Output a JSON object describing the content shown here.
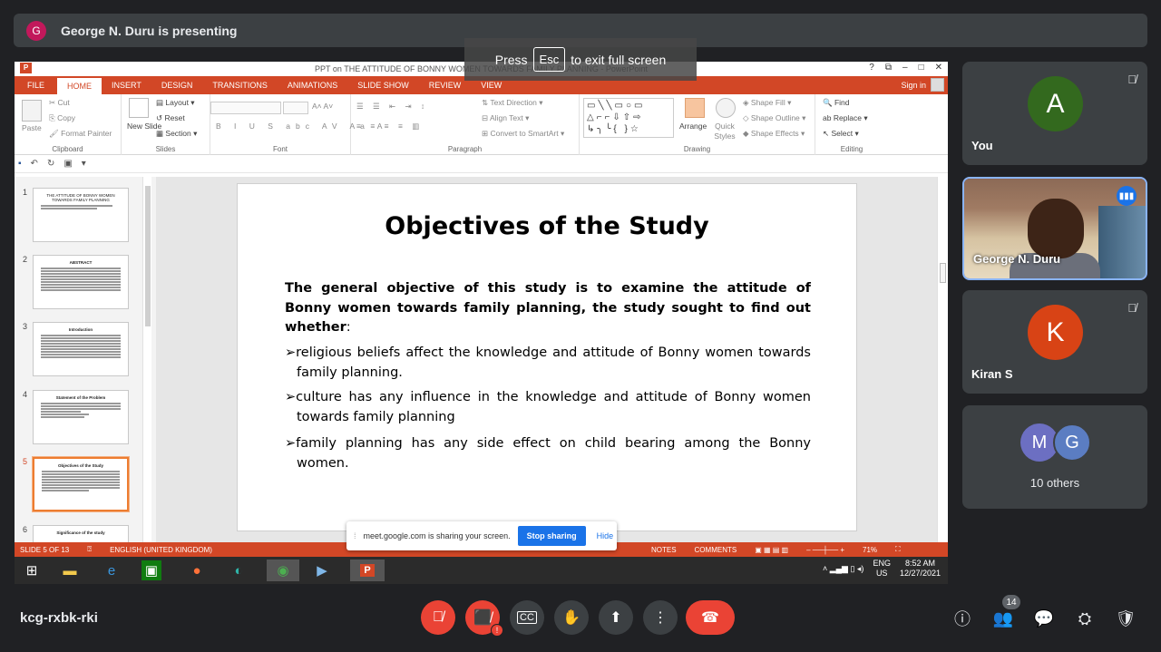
{
  "banner": {
    "avatar_letter": "G",
    "text": "George N. Duru is presenting"
  },
  "fullscreen_notice": {
    "before": "Press",
    "key": "Esc",
    "after": "to exit full screen"
  },
  "ppt": {
    "app_icon": "P",
    "title": "PPT on THE ATTITUDE OF BONNY WOMEN TOWARDS FAMILY PLANNING - PowerPoint",
    "window_controls": [
      "?",
      "⧉",
      "–",
      "□",
      "✕"
    ],
    "tabs": [
      "FILE",
      "HOME",
      "INSERT",
      "DESIGN",
      "TRANSITIONS",
      "ANIMATIONS",
      "SLIDE SHOW",
      "REVIEW",
      "VIEW"
    ],
    "sign_in": "Sign in",
    "ribbon": {
      "clipboard": {
        "paste": "Paste",
        "cut": "Cut",
        "copy": "Copy",
        "format_painter": "Format Painter",
        "label": "Clipboard"
      },
      "slides": {
        "new_slide": "New Slide",
        "layout": "Layout",
        "reset": "Reset",
        "section": "Section",
        "label": "Slides"
      },
      "font": {
        "label": "Font"
      },
      "paragraph": {
        "text_direction": "Text Direction",
        "align_text": "Align Text",
        "convert": "Convert to SmartArt",
        "label": "Paragraph"
      },
      "drawing": {
        "arrange": "Arrange",
        "quick_styles": "Quick Styles",
        "shape_fill": "Shape Fill",
        "shape_outline": "Shape Outline",
        "shape_effects": "Shape Effects",
        "label": "Drawing"
      },
      "editing": {
        "find": "Find",
        "replace": "Replace",
        "select": "Select",
        "label": "Editing"
      }
    },
    "thumbnails": [
      {
        "num": "1",
        "title": "THE ATTITUDE OF BONNY WOMEN TOWARDS FAMILY PLANNING"
      },
      {
        "num": "2",
        "title": "ABSTRACT"
      },
      {
        "num": "3",
        "title": "Introduction"
      },
      {
        "num": "4",
        "title": "Statement of the Problem"
      },
      {
        "num": "5",
        "title": "Objectives of the Study"
      },
      {
        "num": "6",
        "title": "Significance of the study"
      }
    ],
    "slide": {
      "title": "Objectives of the Study",
      "lead": "The general objective of this study is to examine the attitude of Bonny women towards family planning, the study sought to find out whether",
      "lead_end": ":",
      "bullet_marker": "➢",
      "bullets": [
        "religious beliefs affect the knowledge and attitude of Bonny women towards family planning.",
        "culture has any influence in the knowledge and attitude of Bonny women towards family planning",
        "family planning has any side effect on child bearing among the Bonny women."
      ]
    },
    "status": {
      "slide": "SLIDE 5 OF 13",
      "language": "ENGLISH (UNITED KINGDOM)",
      "notes": "NOTES",
      "comments": "COMMENTS",
      "zoom": "71%"
    }
  },
  "sharebar": {
    "message": "meet.google.com is sharing your screen.",
    "stop": "Stop sharing",
    "hide": "Hide"
  },
  "taskbar": {
    "lang_top": "ENG",
    "lang_bottom": "US",
    "time": "8:52 AM",
    "date": "12/27/2021"
  },
  "participants": [
    {
      "letter": "A",
      "name": "You",
      "color": "#33691e"
    },
    {
      "name": "George N. Duru"
    },
    {
      "letter": "K",
      "name": "Kiran S",
      "color": "#d84315"
    }
  ],
  "others": {
    "a": "M",
    "b": "G",
    "label": "10 others"
  },
  "meeting": {
    "code": "kcg-rxbk-rki",
    "people_count": "14"
  },
  "colors": {
    "ppt_accent": "#d24726",
    "meet_bg": "#202124",
    "end_call": "#ea4335"
  }
}
